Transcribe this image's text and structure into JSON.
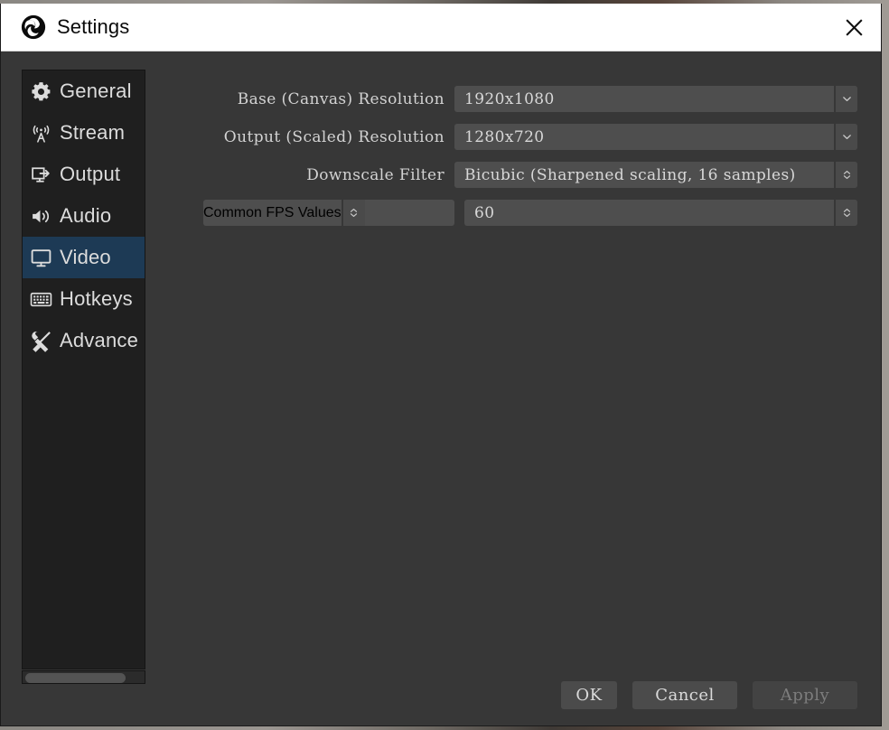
{
  "window": {
    "title": "Settings",
    "logo_icon": "obs-logo-icon",
    "close_icon": "close-icon"
  },
  "sidebar": {
    "items": [
      {
        "label": "General",
        "icon": "gear-icon",
        "selected": false
      },
      {
        "label": "Stream",
        "icon": "broadcast-icon",
        "selected": false
      },
      {
        "label": "Output",
        "icon": "output-icon",
        "selected": false
      },
      {
        "label": "Audio",
        "icon": "speaker-icon",
        "selected": false
      },
      {
        "label": "Video",
        "icon": "monitor-icon",
        "selected": true
      },
      {
        "label": "Hotkeys",
        "icon": "keyboard-icon",
        "selected": false
      },
      {
        "label": "Advance",
        "icon": "tools-icon",
        "selected": false
      }
    ],
    "scrollbar": {
      "orientation": "horizontal"
    }
  },
  "form": {
    "rows": [
      {
        "label": "Base (Canvas) Resolution",
        "value": "1920x1080",
        "control": "combobox",
        "arrow_icon": "chevron-down-icon"
      },
      {
        "label": "Output (Scaled) Resolution",
        "value": "1280x720",
        "control": "combobox",
        "arrow_icon": "chevron-down-icon"
      },
      {
        "label": "Downscale Filter",
        "value": "Bicubic (Sharpened scaling, 16 samples)",
        "control": "combobox",
        "arrow_icon": "chevron-up-down-icon"
      }
    ],
    "fps_row": {
      "type_value": "Common FPS Values",
      "type_arrow_icon": "chevron-up-down-icon",
      "value": "60",
      "arrow_icon": "chevron-up-down-icon"
    }
  },
  "footer": {
    "buttons": [
      {
        "label": "OK",
        "enabled": true
      },
      {
        "label": "Cancel",
        "enabled": true
      },
      {
        "label": "Apply",
        "enabled": false
      }
    ]
  },
  "colors": {
    "titlebar_bg": "#ffffff",
    "panel_bg": "#373737",
    "sidebar_bg": "#1f1f1f",
    "selection": "#1d3a55",
    "control_bg": "#4e4e4e",
    "text": "#d8d8d8"
  }
}
